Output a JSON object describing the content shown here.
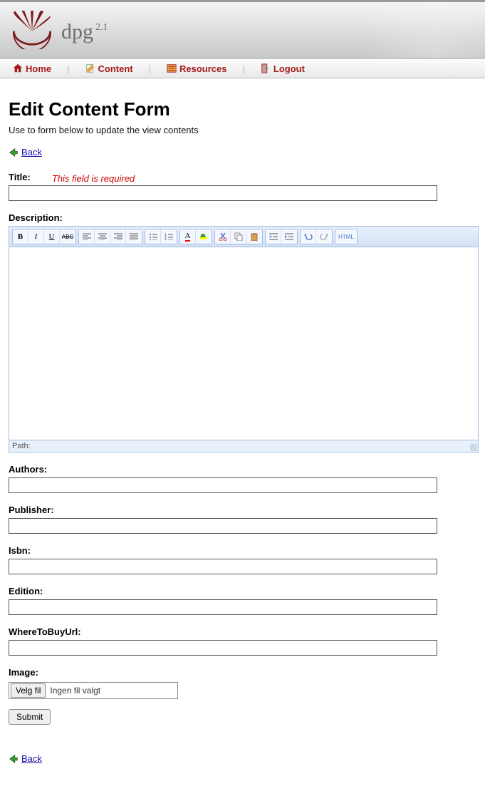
{
  "brand": {
    "name": "dpg",
    "version": "2.1"
  },
  "nav": {
    "home": "Home",
    "content": "Content",
    "resources": "Resources",
    "logout": "Logout"
  },
  "page": {
    "title": "Edit Content Form",
    "subtitle": "Use to form below to update the view contents"
  },
  "back": {
    "label": "Back"
  },
  "fields": {
    "title": {
      "label": "Title:",
      "required_msg": "This field is required",
      "value": ""
    },
    "description": {
      "label": "Description:",
      "value": ""
    },
    "authors": {
      "label": "Authors:",
      "value": ""
    },
    "publisher": {
      "label": "Publisher:",
      "value": ""
    },
    "isbn": {
      "label": "Isbn:",
      "value": ""
    },
    "edition": {
      "label": "Edition:",
      "value": ""
    },
    "where": {
      "label": "WhereToBuyUrl:",
      "value": ""
    },
    "image": {
      "label": "Image:",
      "button": "Velg fil",
      "none": "Ingen fil valgt"
    }
  },
  "editor": {
    "path_label": "Path:",
    "html_btn": "HTML"
  },
  "submit": "Submit"
}
